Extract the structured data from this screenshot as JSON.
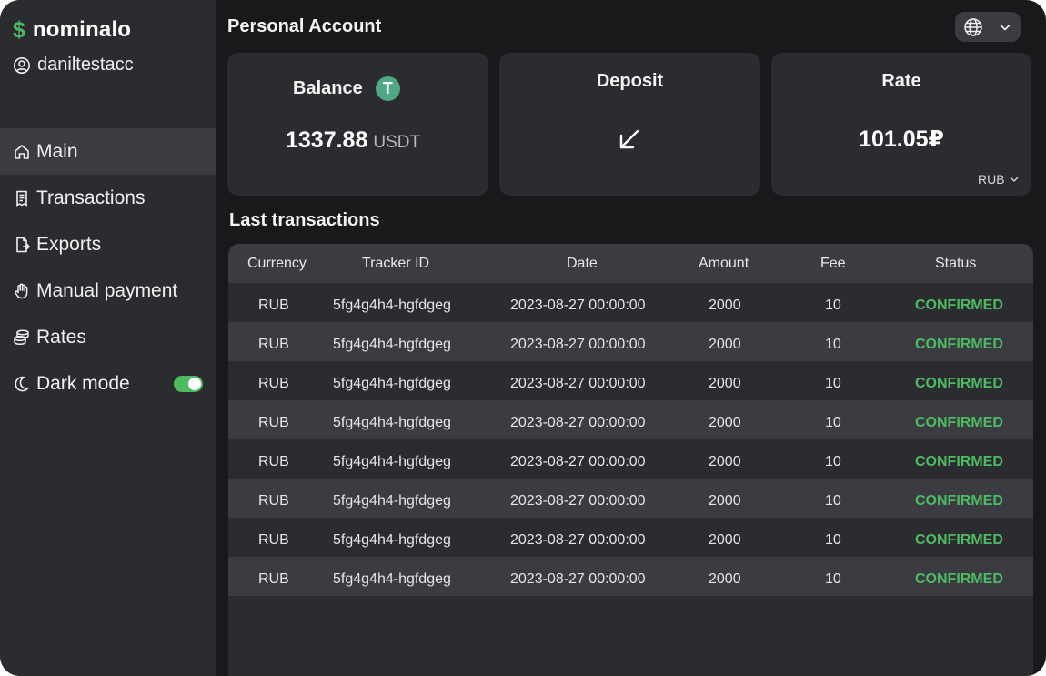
{
  "app": {
    "brand_icon": "$",
    "brand_name": "nominalo",
    "username": "daniltestacc",
    "accent_color": "#4dbb62"
  },
  "sidebar": {
    "items": [
      {
        "label": "Main",
        "icon": "home-icon",
        "active": true
      },
      {
        "label": "Transactions",
        "icon": "receipt-icon"
      },
      {
        "label": "Exports",
        "icon": "file-export-icon"
      },
      {
        "label": "Manual payment",
        "icon": "hand-icon"
      },
      {
        "label": "Rates",
        "icon": "coins-icon"
      },
      {
        "label": "Dark mode",
        "icon": "moon-icon",
        "toggle_on": true
      }
    ]
  },
  "header": {
    "title": "Personal Account",
    "language_icon": "globe-icon"
  },
  "cards": {
    "balance": {
      "title": "Balance",
      "value": "1337.88",
      "unit": "USDT",
      "coin_icon": "tether-icon",
      "coin_glyph": "T"
    },
    "deposit": {
      "title": "Deposit",
      "icon": "arrow-down-left-icon"
    },
    "rate": {
      "title": "Rate",
      "value": "101.05₽",
      "currency": "RUB"
    }
  },
  "transactions": {
    "title": "Last transactions",
    "columns": [
      "Currency",
      "Tracker ID",
      "Date",
      "Amount",
      "Fee",
      "Status"
    ],
    "rows": [
      {
        "currency": "RUB",
        "tracker": "5fg4g4h4-hgfdgeg",
        "date": "2023-08-27 00:00:00",
        "amount": "2000",
        "fee": "10",
        "status": "CONFIRMED"
      },
      {
        "currency": "RUB",
        "tracker": "5fg4g4h4-hgfdgeg",
        "date": "2023-08-27 00:00:00",
        "amount": "2000",
        "fee": "10",
        "status": "CONFIRMED"
      },
      {
        "currency": "RUB",
        "tracker": "5fg4g4h4-hgfdgeg",
        "date": "2023-08-27 00:00:00",
        "amount": "2000",
        "fee": "10",
        "status": "CONFIRMED"
      },
      {
        "currency": "RUB",
        "tracker": "5fg4g4h4-hgfdgeg",
        "date": "2023-08-27 00:00:00",
        "amount": "2000",
        "fee": "10",
        "status": "CONFIRMED"
      },
      {
        "currency": "RUB",
        "tracker": "5fg4g4h4-hgfdgeg",
        "date": "2023-08-27 00:00:00",
        "amount": "2000",
        "fee": "10",
        "status": "CONFIRMED"
      },
      {
        "currency": "RUB",
        "tracker": "5fg4g4h4-hgfdgeg",
        "date": "2023-08-27 00:00:00",
        "amount": "2000",
        "fee": "10",
        "status": "CONFIRMED"
      },
      {
        "currency": "RUB",
        "tracker": "5fg4g4h4-hgfdgeg",
        "date": "2023-08-27 00:00:00",
        "amount": "2000",
        "fee": "10",
        "status": "CONFIRMED"
      },
      {
        "currency": "RUB",
        "tracker": "5fg4g4h4-hgfdgeg",
        "date": "2023-08-27 00:00:00",
        "amount": "2000",
        "fee": "10",
        "status": "CONFIRMED"
      }
    ]
  }
}
